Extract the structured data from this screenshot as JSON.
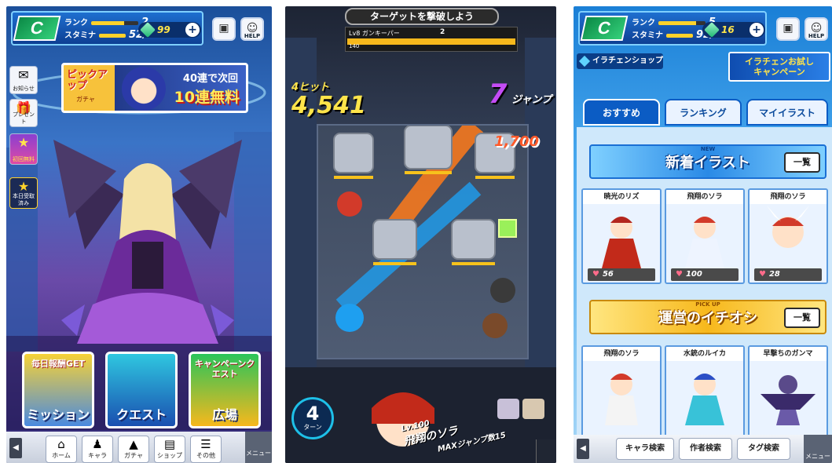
{
  "screen1": {
    "status": {
      "rank_label": "ランク",
      "rank_value": "2",
      "stamina_label": "スタミナ",
      "stamina_value": "52/32",
      "gems": "99",
      "help_label": "HELP"
    },
    "side": [
      {
        "label": "お知らせ",
        "icon": "mail-icon"
      },
      {
        "label": "プレゼント",
        "icon": "gift-icon"
      },
      {
        "label": "初回無料",
        "icon": "gacha-banner-icon"
      },
      {
        "label": "本日受取済み",
        "icon": "login-bonus-icon"
      }
    ],
    "pickup": {
      "title": "ピックアップ",
      "sub": "ガチャ",
      "line1": "40連で次回",
      "line2": "10連無料"
    },
    "tiles": [
      {
        "top": "毎日報酬GET",
        "label": "ミッション"
      },
      {
        "top": "",
        "label": "クエスト"
      },
      {
        "top": "キャンペーンクエスト",
        "label": "広場"
      }
    ],
    "nav": [
      {
        "label": "ホーム",
        "icon": "home-icon"
      },
      {
        "label": "キャラ",
        "icon": "character-icon"
      },
      {
        "label": "ガチャ",
        "icon": "gacha-icon"
      },
      {
        "label": "ショップ",
        "icon": "shop-icon"
      },
      {
        "label": "その他",
        "icon": "list-icon"
      }
    ],
    "menu_label": "メニュー"
  },
  "screen2": {
    "target": "ターゲットを撃破しよう",
    "enemy_level": "Lv8",
    "enemy_name": "ガンキーパー",
    "enemy_count": "2",
    "enemy_hp": "140",
    "combo_count": "4ヒット",
    "combo_damage": "4,541",
    "jump_count": "7",
    "jump_label": "ジャンプ",
    "damage_popup": "1,700",
    "turn_value": "4",
    "turn_label": "ターン",
    "char_level": "Lv.100",
    "char_name": "飛翔のソラ",
    "char_max": "MAXジャンプ数15"
  },
  "screen3": {
    "status": {
      "rank_label": "ランク",
      "rank_value": "5",
      "stamina_label": "スタミナ",
      "stamina_value": "92/38",
      "gems": "16",
      "help_label": "HELP"
    },
    "shop_label": "イラチェンショップ",
    "campaign_l1": "イラチェンお試し",
    "campaign_l2": "キャンペーン",
    "tabs": [
      "おすすめ",
      "ランキング",
      "マイイラスト"
    ],
    "section_new": {
      "tag": "NEW",
      "title": "新着イラスト",
      "more": "一覧"
    },
    "section_pick": {
      "tag": "PICK UP",
      "title": "運営のイチオシ",
      "more": "一覧"
    },
    "new_cards": [
      {
        "name": "暁光のリズ",
        "likes": "56"
      },
      {
        "name": "飛翔のソラ",
        "likes": "100"
      },
      {
        "name": "飛翔のソラ",
        "likes": "28"
      }
    ],
    "pick_cards": [
      {
        "name": "飛翔のソラ"
      },
      {
        "name": "水銃のルイカ"
      },
      {
        "name": "早撃ちのガンマ"
      }
    ],
    "nav": [
      "キャラ検索",
      "作者検索",
      "タグ検索"
    ],
    "menu_label": "メニュー"
  }
}
